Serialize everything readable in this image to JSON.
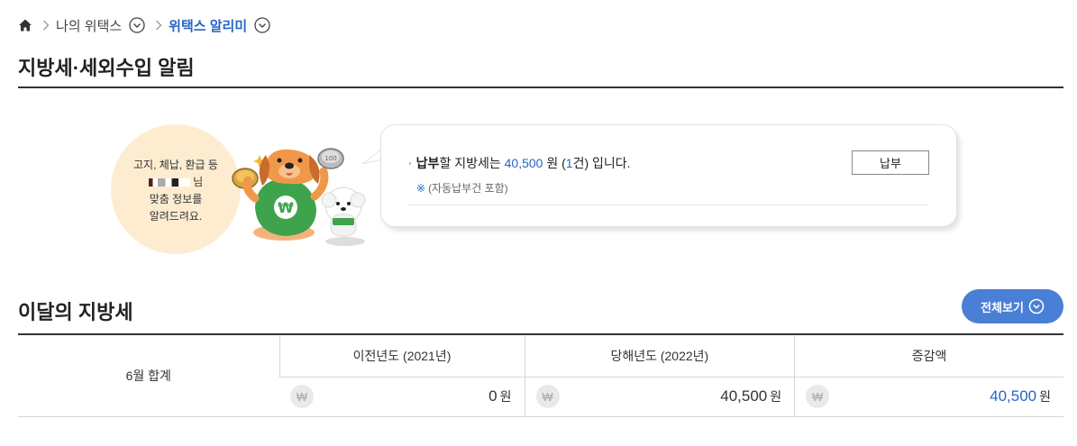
{
  "breadcrumb": {
    "level1": "나의 위택스",
    "level2": "위택스 알리미"
  },
  "page_title": "지방세·세외수입 알림",
  "banner": {
    "line1": "고지, 체납, 환급 등",
    "name_suffix": "님",
    "line3": "맞춤 정보를",
    "line4": "알려드려요.",
    "message": {
      "bold": "납부",
      "pre": "할 지방세는 ",
      "amount": "40,500",
      "mid": " 원 (",
      "count": "1",
      "post": "건) 입니다."
    },
    "note_mark": "※",
    "note": "(자동납부건 포함)",
    "pay_button": "납부"
  },
  "section": {
    "title": "이달의 지방세",
    "view_all": "전체보기"
  },
  "table": {
    "row_label": "6월 합계",
    "headers": [
      "이전년도 (2021년)",
      "당해년도 (2022년)",
      "증감액"
    ],
    "values": [
      "0",
      "40,500",
      "40,500"
    ],
    "unit": "원",
    "won_symbol": "₩"
  },
  "colors": {
    "accent": "#2566c8",
    "button": "#4a7fd6",
    "circle": "#fdecd0"
  }
}
